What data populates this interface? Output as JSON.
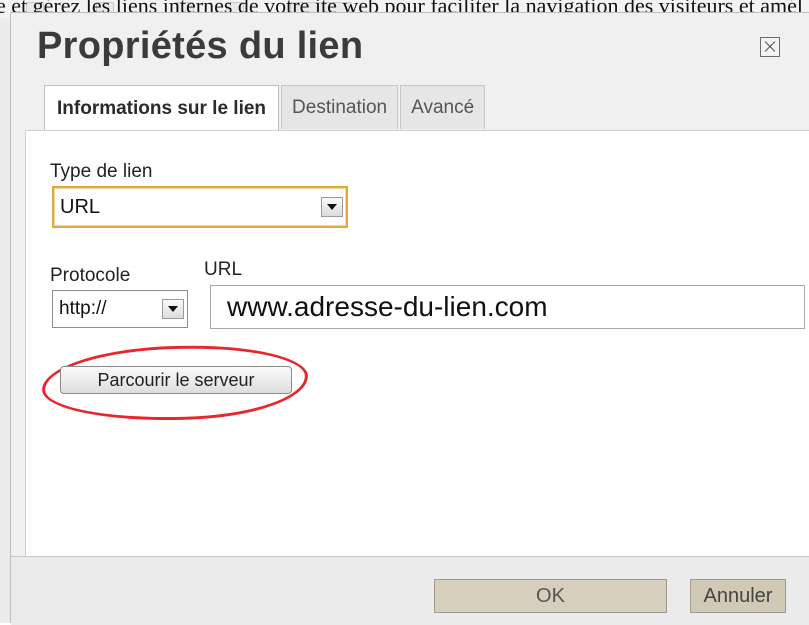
{
  "dialog": {
    "title": "Propriétés du lien",
    "tabs": [
      {
        "label": "Informations sur le lien",
        "active": true
      },
      {
        "label": "Destination",
        "active": false
      },
      {
        "label": "Avancé",
        "active": false
      }
    ]
  },
  "link_info": {
    "type_label": "Type de lien",
    "type_value": "URL",
    "protocol_label": "Protocole",
    "protocol_value": "http://",
    "url_label": "URL",
    "url_value": "www.adresse-du-lien.com",
    "browse_button": "Parcourir le serveur"
  },
  "footer": {
    "ok_label": "OK",
    "cancel_label": "Annuler"
  },
  "background": {
    "partial_text": "e et gérez les liens internes de votre ite web pour faciliter la navigation des visiteurs et amél"
  },
  "colors": {
    "highlight": "#e8262b",
    "focus_ring": "#e0a83a"
  }
}
